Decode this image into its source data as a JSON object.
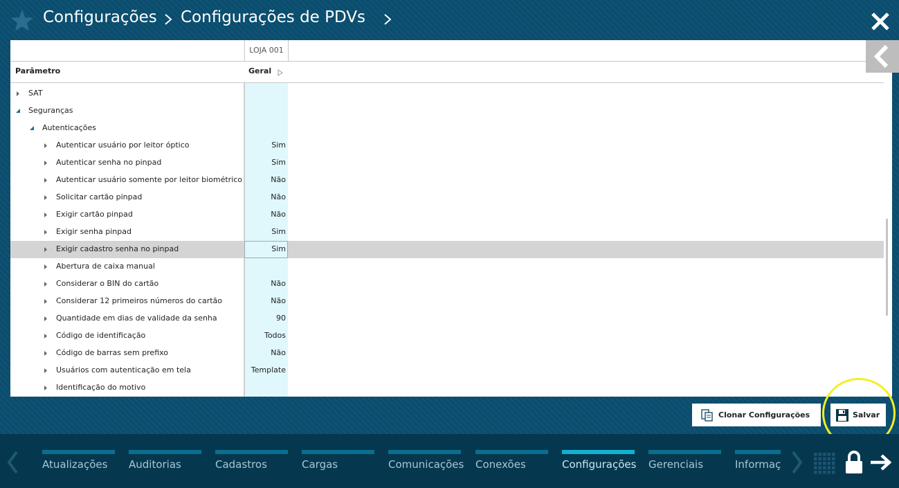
{
  "breadcrumb": {
    "items": [
      "Configurações",
      "Configurações de PDVs"
    ]
  },
  "grid": {
    "store_header": "LOJA 001",
    "param_header": "Parâmetro",
    "value_header": "Geral",
    "rows": [
      {
        "label": "SAT",
        "value": "",
        "level": 0,
        "expanded": false
      },
      {
        "label": "Seguranças",
        "value": "",
        "level": 0,
        "expanded": true
      },
      {
        "label": "Autenticações",
        "value": "",
        "level": 1,
        "expanded": true
      },
      {
        "label": "Autenticar usuário por leitor óptico",
        "value": "Sim",
        "level": 2,
        "expanded": false
      },
      {
        "label": "Autenticar senha no pinpad",
        "value": "Sim",
        "level": 2,
        "expanded": false
      },
      {
        "label": "Autenticar usuário somente por leitor biométrico",
        "value": "Não",
        "level": 2,
        "expanded": false
      },
      {
        "label": "Solicitar cartão pinpad",
        "value": "Não",
        "level": 2,
        "expanded": false
      },
      {
        "label": "Exigir cartão pinpad",
        "value": "Não",
        "level": 2,
        "expanded": false
      },
      {
        "label": "Exigir senha pinpad",
        "value": "Sim",
        "level": 2,
        "expanded": false
      },
      {
        "label": "Exigir cadastro senha no pinpad",
        "value": "Sim",
        "level": 2,
        "expanded": false,
        "selected": true
      },
      {
        "label": "Abertura de caixa manual",
        "value": "",
        "level": 2,
        "expanded": false
      },
      {
        "label": "Considerar o BIN do cartão",
        "value": "Não",
        "level": 2,
        "expanded": false
      },
      {
        "label": "Considerar 12 primeiros números do cartão",
        "value": "Não",
        "level": 2,
        "expanded": false
      },
      {
        "label": "Quantidade em dias de validade da senha",
        "value": "90",
        "level": 2,
        "expanded": false
      },
      {
        "label": "Código de identificação",
        "value": "Todos",
        "level": 2,
        "expanded": false
      },
      {
        "label": "Código de barras sem prefixo",
        "value": "Não",
        "level": 2,
        "expanded": false
      },
      {
        "label": "Usuários com autenticação em tela",
        "value": "Template",
        "level": 2,
        "expanded": false
      },
      {
        "label": "Identificação do motivo",
        "value": "",
        "level": 2,
        "expanded": false
      }
    ]
  },
  "actions": {
    "clone_label": "Clonar Configurações",
    "save_label": "Salvar"
  },
  "nav": {
    "tabs": [
      {
        "label": "Atualizações",
        "active": false
      },
      {
        "label": "Auditorias",
        "active": false
      },
      {
        "label": "Cadastros",
        "active": false
      },
      {
        "label": "Cargas",
        "active": false
      },
      {
        "label": "Comunicações",
        "active": false
      },
      {
        "label": "Conexões",
        "active": false
      },
      {
        "label": "Configurações",
        "active": true
      },
      {
        "label": "Gerenciais",
        "active": false
      },
      {
        "label": "Informaç",
        "active": false
      }
    ]
  },
  "colors": {
    "background": "#0a4d6e",
    "nav_background": "#05384f",
    "value_column": "#e0f8fb",
    "selected_row": "#d4d4d4",
    "active_tab": "#12b1d1",
    "tab_bar": "#0b6e8e",
    "highlight": "#f4ef21"
  },
  "icons": {
    "favorite": "star-icon",
    "close": "close-icon",
    "collapse": "chevron-left-icon",
    "clone": "clone-icon",
    "save": "floppy-disk-icon",
    "apps": "grid-icon",
    "lock": "lock-icon",
    "exit": "arrow-right-icon"
  }
}
